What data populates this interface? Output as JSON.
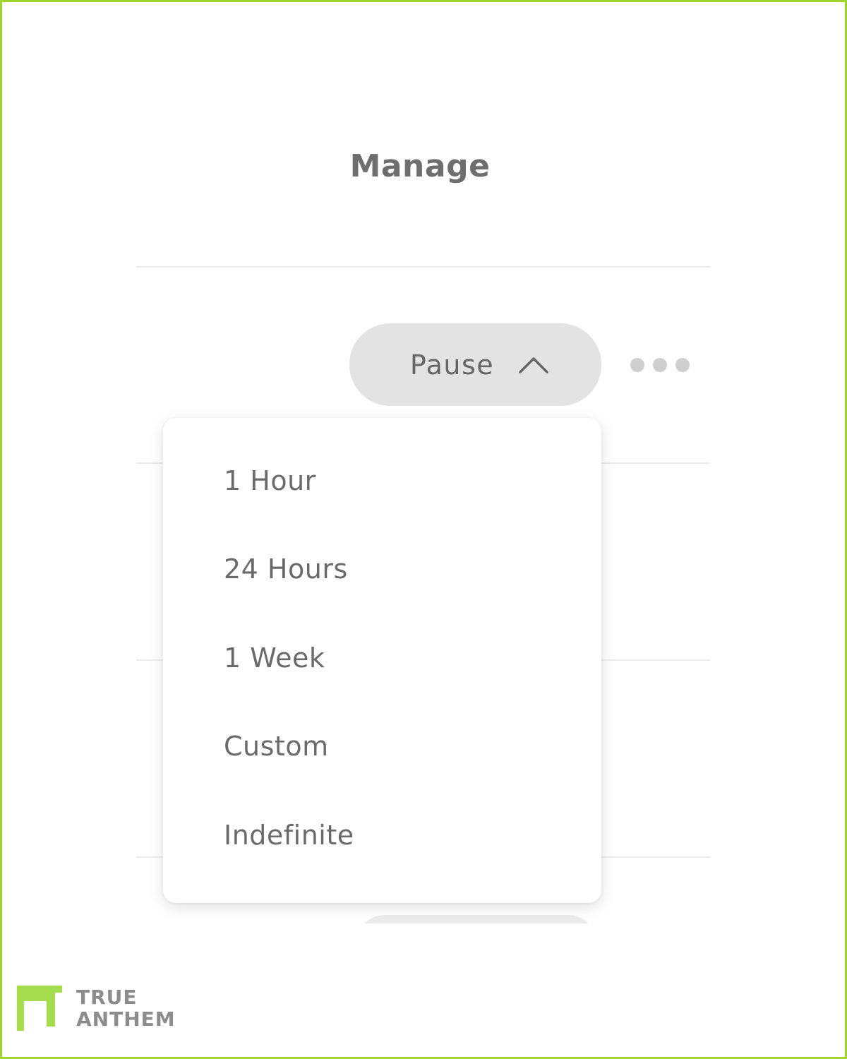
{
  "header": {
    "title": "Manage"
  },
  "pause_button": {
    "label": "Pause",
    "icon": "chevron-up-icon",
    "expanded": true
  },
  "more_menu": {
    "icon": "more-horizontal-icon"
  },
  "pause_dropdown": {
    "options": [
      {
        "label": "1 Hour"
      },
      {
        "label": "24 Hours"
      },
      {
        "label": "1 Week"
      },
      {
        "label": "Custom"
      },
      {
        "label": "Indefinite"
      }
    ]
  },
  "brand": {
    "line1": "TRUE",
    "line2": "ANTHEM",
    "accent_color": "#a6dd4e",
    "frame_color": "#9ed62a"
  }
}
